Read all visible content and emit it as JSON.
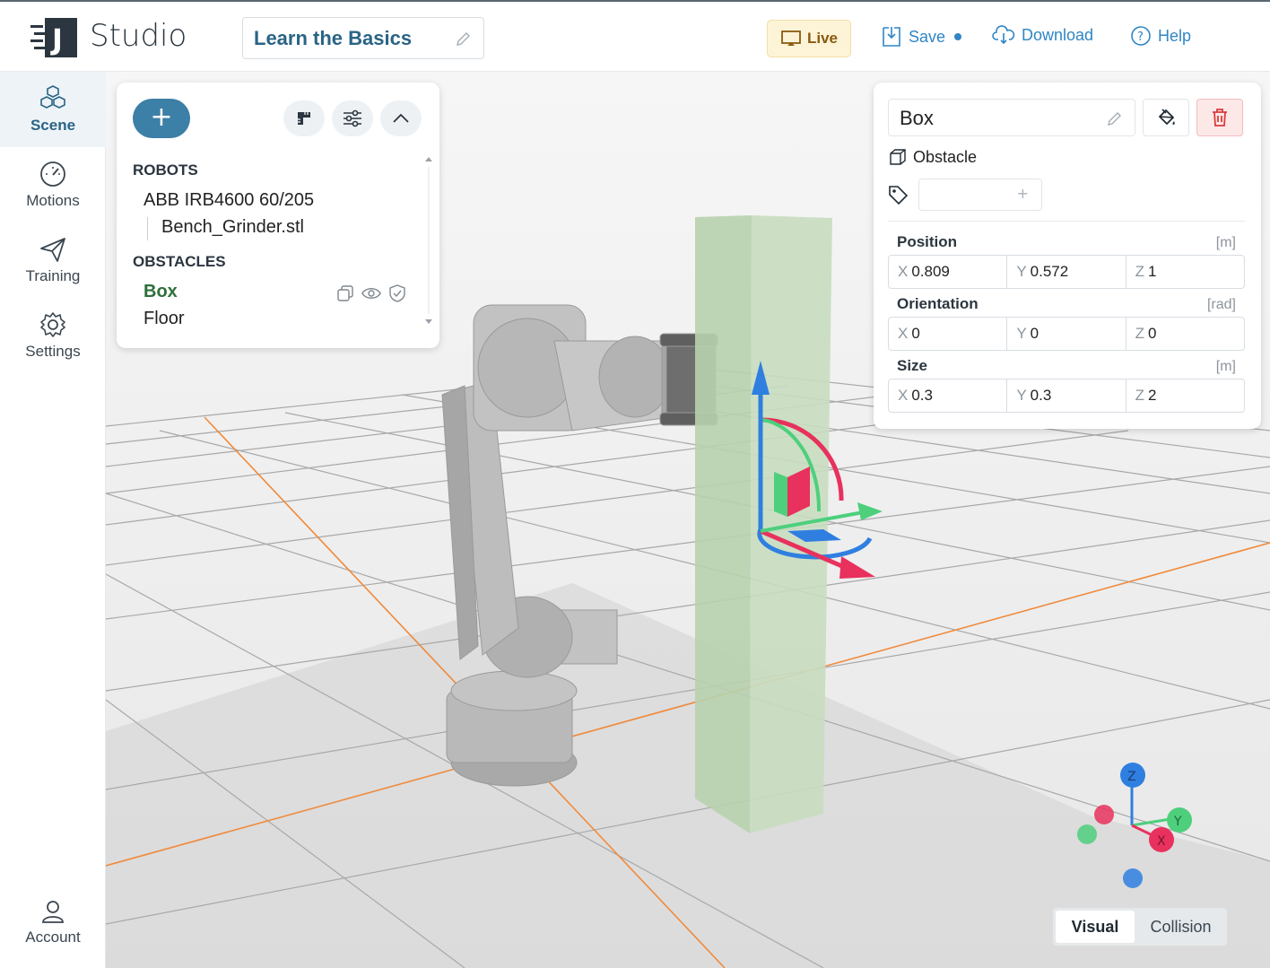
{
  "app": {
    "name": "Studio"
  },
  "project": {
    "name": "Learn the Basics"
  },
  "topbar": {
    "live_label": "Live",
    "save_label": "Save",
    "download_label": "Download",
    "help_label": "Help"
  },
  "sidebar": {
    "items": [
      {
        "label": "Scene",
        "active": true
      },
      {
        "label": "Motions"
      },
      {
        "label": "Training"
      },
      {
        "label": "Settings"
      }
    ],
    "account_label": "Account"
  },
  "scene_panel": {
    "robots_title": "ROBOTS",
    "robot_name": "ABB IRB4600 60/205",
    "robot_child": "Bench_Grinder.stl",
    "obstacles_title": "OBSTACLES",
    "obstacles": [
      "Box",
      "Floor"
    ]
  },
  "properties": {
    "name": "Box",
    "type": "Obstacle",
    "position": {
      "label": "Position",
      "unit": "[m]",
      "x": "0.809",
      "y": "0.572",
      "z": "1"
    },
    "orientation": {
      "label": "Orientation",
      "unit": "[rad]",
      "x": "0",
      "y": "0",
      "z": "0"
    },
    "size": {
      "label": "Size",
      "unit": "[m]",
      "x": "0.3",
      "y": "0.3",
      "z": "2"
    },
    "axis_labels": {
      "x": "X",
      "y": "Y",
      "z": "Z"
    },
    "tag_add": "+"
  },
  "view_toggle": {
    "visual": "Visual",
    "collision": "Collision",
    "active": "Visual"
  },
  "axes_widget": {
    "z": "Z",
    "y": "Y",
    "x": "X"
  },
  "colors": {
    "accent": "#2f86c5",
    "primary": "#3c7fa7",
    "box": "#b9d3b0",
    "axis_x": "#e8315d",
    "axis_y": "#4ecf7c",
    "axis_z": "#2f7fe0"
  }
}
